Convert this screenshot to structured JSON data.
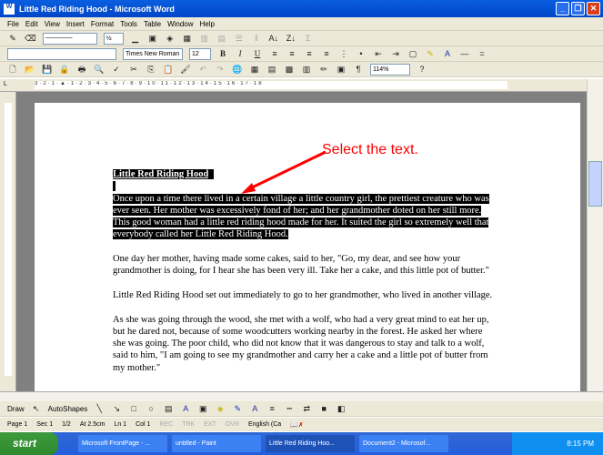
{
  "window": {
    "title": "Little Red Riding Hood - Microsoft Word"
  },
  "menu": [
    "File",
    "Edit",
    "View",
    "Insert",
    "Format",
    "Tools",
    "Table",
    "Window",
    "Help"
  ],
  "formatting": {
    "style": "",
    "font": "Times New Roman",
    "size": "12"
  },
  "standard": {
    "zoom": "114%"
  },
  "tables_toolbar": {
    "line_weight": "½"
  },
  "callout": "Select the text.",
  "document": {
    "title": "Little Red Riding Hood",
    "paragraphs": [
      "Once upon a time there lived in a certain village a little country girl, the prettiest creature who was ever seen. Her mother was excessively fond of her; and her grandmother doted on her still more. This good woman had a little red riding hood made for her. It suited the girl so extremely well that everybody called her Little Red Riding Hood.",
      "One day her mother, having made some cakes, said to her, \"Go, my dear, and see how your grandmother is doing, for I hear she has been very ill. Take her a cake, and this little pot of butter.\"",
      "Little Red Riding Hood set out immediately to go to her grandmother, who lived in another village.",
      "As she was going through the wood, she met with a wolf, who had a very great mind to eat her up, but he dared not, because of some woodcutters working nearby in the forest. He asked her where she was going. The poor child, who did not know that it was dangerous to stay and talk to a wolf, said to him, \"I am going to see my grandmother and carry her a cake and a little pot of butter from my mother.\""
    ]
  },
  "draw": {
    "draw": "Draw",
    "autoshapes": "AutoShapes"
  },
  "status": {
    "page": "Page 1",
    "sec": "Sec 1",
    "pages": "1/2",
    "at": "At 2.5cm",
    "ln": "Ln 1",
    "col": "Col 1",
    "rec": "REC",
    "trk": "TRK",
    "ext": "EXT",
    "ovr": "OVR",
    "lang": "English (Ca"
  },
  "taskbar": {
    "start": "start",
    "tasks": [
      "Microsoft FrontPage - ...",
      "untitled - Paint",
      "Little Red Riding Hoo...",
      "Document2 - Microsof..."
    ],
    "clock": "8:15 PM"
  }
}
